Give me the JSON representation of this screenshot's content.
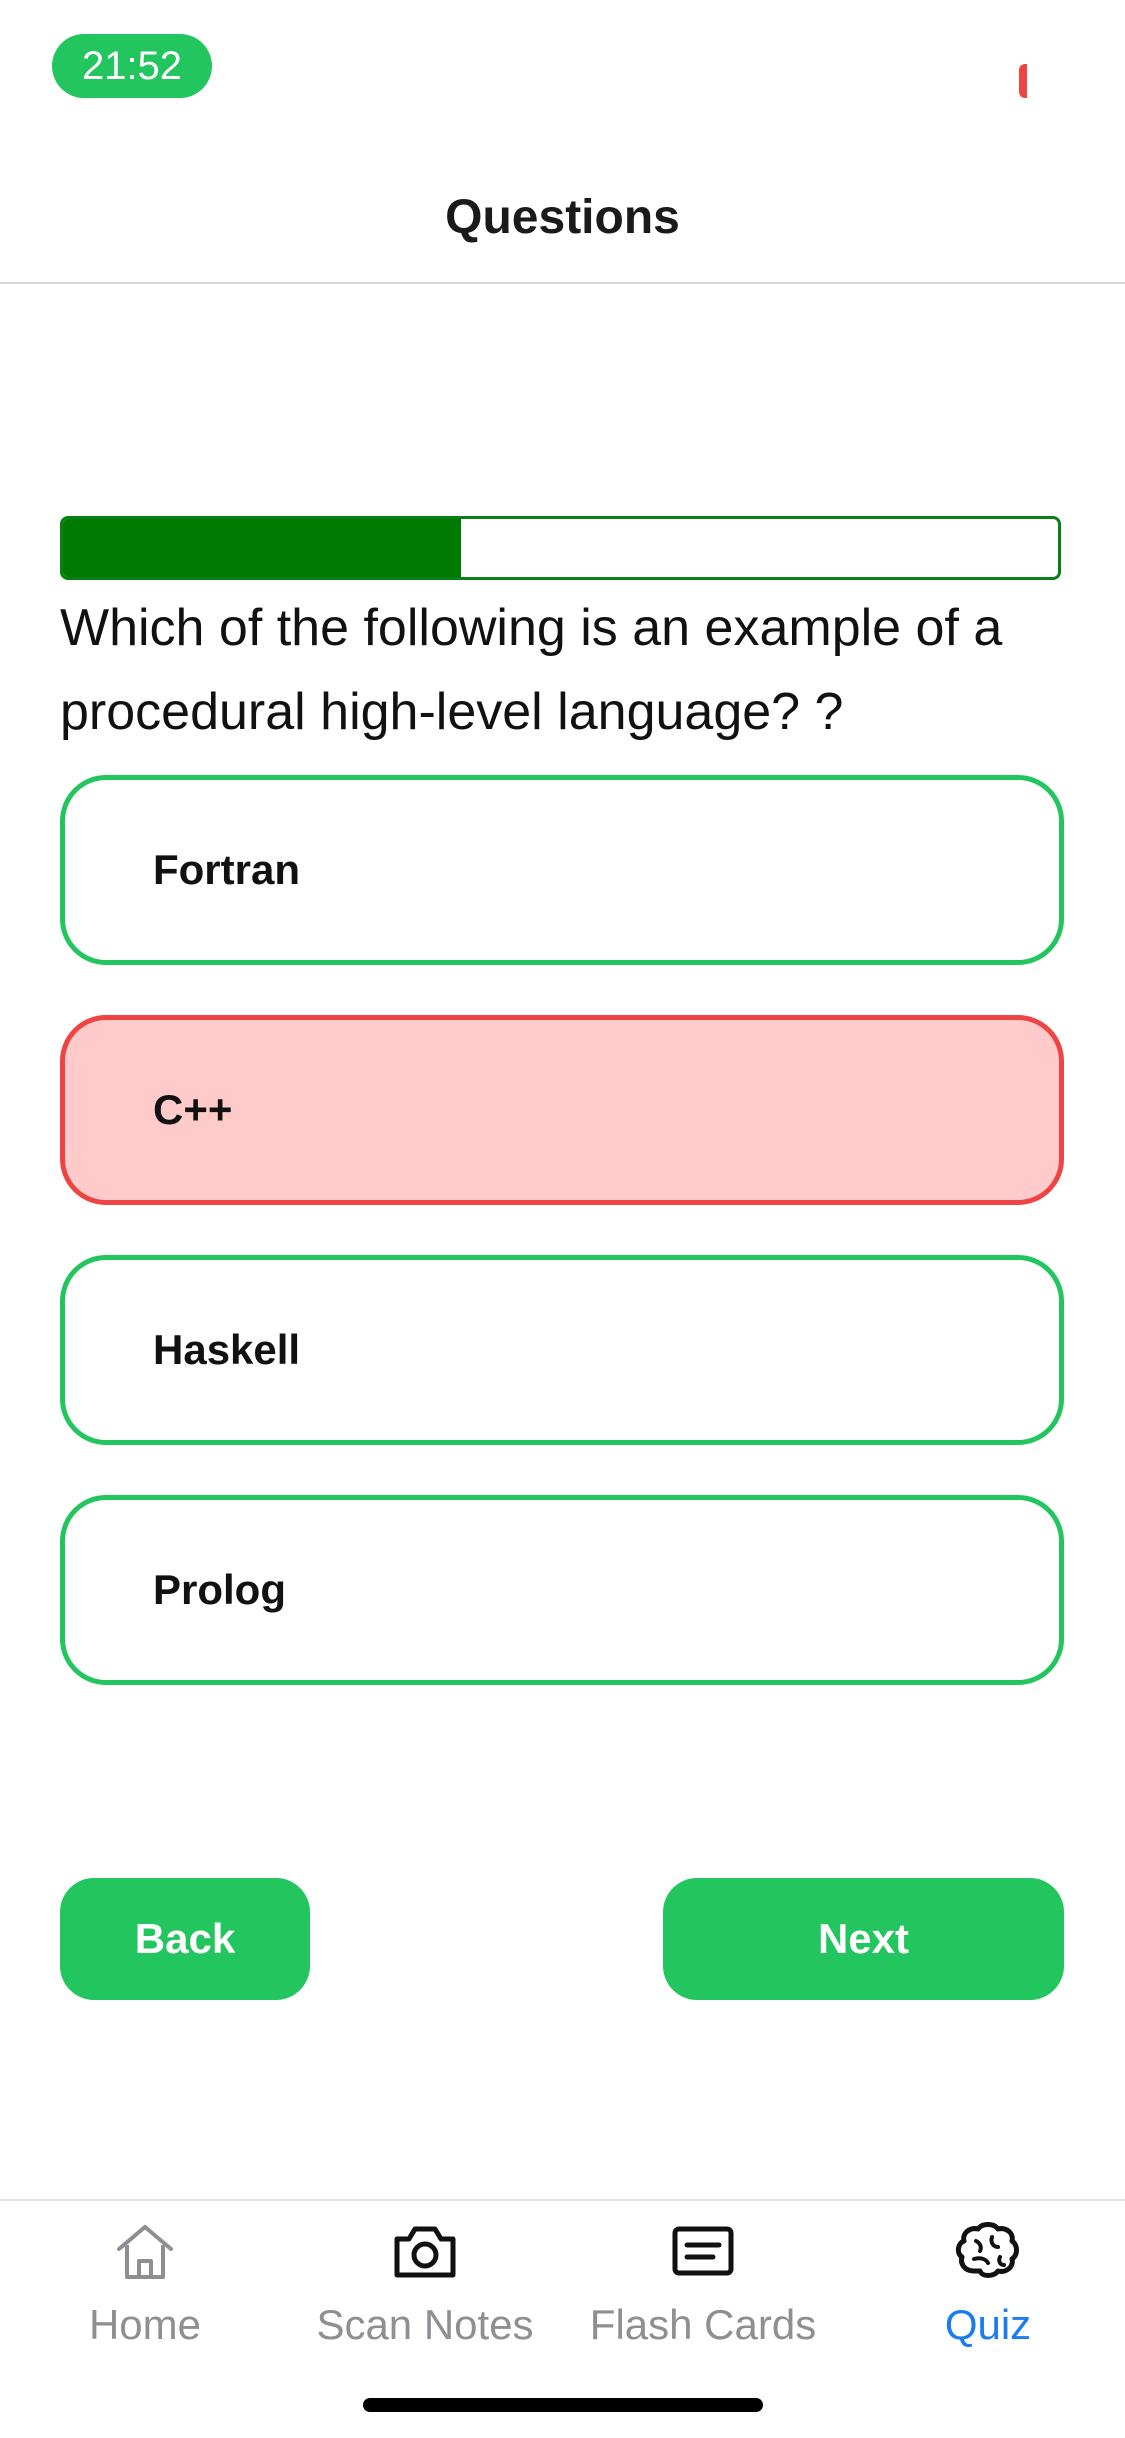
{
  "status_bar": {
    "time": "21:52"
  },
  "header": {
    "title": "Questions"
  },
  "quiz": {
    "progress_fraction": 0.4,
    "question": "Which of the following is an example of a procedural high-level language? ?",
    "options": [
      {
        "label": "Fortran",
        "state": "default"
      },
      {
        "label": "C++",
        "state": "incorrect"
      },
      {
        "label": "Haskell",
        "state": "default"
      },
      {
        "label": "Prolog",
        "state": "default"
      }
    ],
    "back_label": "Back",
    "next_label": "Next"
  },
  "tabbar": {
    "items": [
      {
        "label": "Home",
        "icon": "home-icon",
        "active": false
      },
      {
        "label": "Scan Notes",
        "icon": "camera-icon",
        "active": false
      },
      {
        "label": "Flash Cards",
        "icon": "card-icon",
        "active": false
      },
      {
        "label": "Quiz",
        "icon": "brain-icon",
        "active": true
      }
    ]
  },
  "colors": {
    "accent_green": "#22c55e",
    "progress_green": "#007a00",
    "incorrect_red": "#ef4444",
    "incorrect_fill": "#fecaca",
    "active_tab_blue": "#1a7cf0",
    "inactive_tab_gray": "#8e8e93"
  }
}
